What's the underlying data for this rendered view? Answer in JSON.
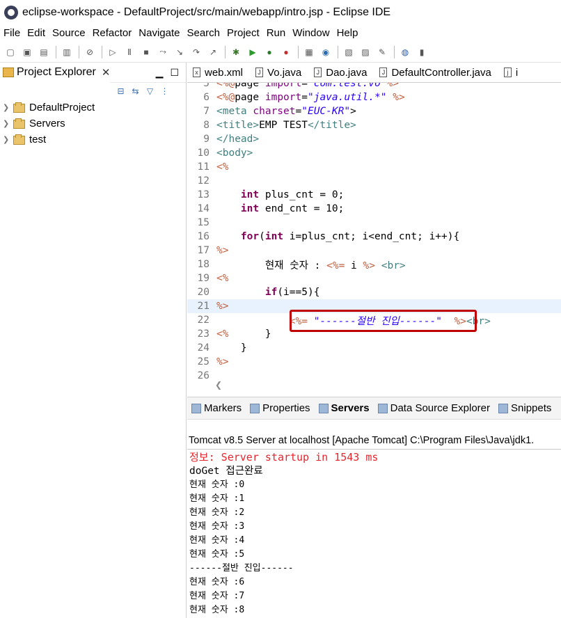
{
  "window": {
    "title": "eclipse-workspace - DefaultProject/src/main/webapp/intro.jsp - Eclipse IDE"
  },
  "menu": [
    "File",
    "Edit",
    "Source",
    "Refactor",
    "Navigate",
    "Search",
    "Project",
    "Run",
    "Window",
    "Help"
  ],
  "project_explorer": {
    "tab_label": "Project Explorer",
    "items": [
      {
        "label": "DefaultProject"
      },
      {
        "label": "Servers"
      },
      {
        "label": "test"
      }
    ]
  },
  "editor": {
    "tabs": [
      "web.xml",
      "Vo.java",
      "Dao.java",
      "DefaultController.java",
      "i"
    ],
    "lines": [
      {
        "n": "5",
        "t": "<%@page import=\"com.test.vo\"%>"
      },
      {
        "n": "6",
        "t": "<%@page import=\"java.util.*\" %>"
      },
      {
        "n": "7",
        "t": "<meta charset=\"EUC-KR\">"
      },
      {
        "n": "8",
        "t": "<title>EMP TEST</title>"
      },
      {
        "n": "9",
        "t": "</head>"
      },
      {
        "n": "10",
        "t": "<body>"
      },
      {
        "n": "11",
        "t": "<%"
      },
      {
        "n": "12",
        "t": ""
      },
      {
        "n": "13",
        "t": "    int plus_cnt = 0;"
      },
      {
        "n": "14",
        "t": "    int end_cnt = 10;"
      },
      {
        "n": "15",
        "t": ""
      },
      {
        "n": "16",
        "t": "    for(int i=plus_cnt; i<end_cnt; i++){"
      },
      {
        "n": "17",
        "t": "%>"
      },
      {
        "n": "18",
        "t": "        현재 숫자 : <%= i %> <br>"
      },
      {
        "n": "19",
        "t": "<%"
      },
      {
        "n": "20",
        "t": "        if(i==5){"
      },
      {
        "n": "21",
        "t": "%>"
      },
      {
        "n": "22",
        "t": "            <%= \"------절반 진입------\"  %><br>"
      },
      {
        "n": "23",
        "t": "<%      }"
      },
      {
        "n": "24",
        "t": "    }"
      },
      {
        "n": "25",
        "t": "%>"
      },
      {
        "n": "26",
        "t": ""
      }
    ]
  },
  "bottom_panel": {
    "tabs": [
      "Markers",
      "Properties",
      "Servers",
      "Data Source Explorer",
      "Snippets"
    ],
    "active_tab": "Servers",
    "server_line": "Tomcat v8.5 Server at localhost [Apache Tomcat] C:\\Program Files\\Java\\jdk1.",
    "console": [
      "정보: Server startup in 1543 ms",
      "doGet 접근완료",
      "현재 숫자 :0",
      "현재 숫자 :1",
      "현재 숫자 :2",
      "현재 숫자 :3",
      "현재 숫자 :4",
      "현재 숫자 :5",
      "------절반 진입------",
      "현재 숫자 :6",
      "현재 숫자 :7",
      "현재 숫자 :8"
    ]
  }
}
